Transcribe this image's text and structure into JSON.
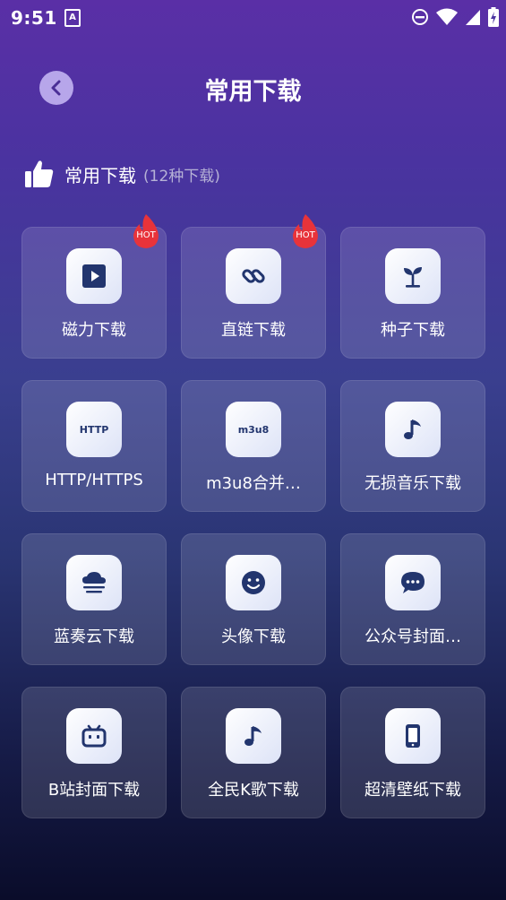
{
  "status_bar": {
    "time": "9:51",
    "notif_icon": "A"
  },
  "header": {
    "title": "常用下载"
  },
  "section": {
    "title": "常用下载",
    "count": "(12种下载)"
  },
  "hot_badge": "HOT",
  "items": [
    {
      "label": "磁力下载",
      "icon": "play-icon",
      "hot": true
    },
    {
      "label": "直链下载",
      "icon": "link-icon",
      "hot": true
    },
    {
      "label": "种子下载",
      "icon": "sprout-icon",
      "hot": false
    },
    {
      "label": "HTTP/HTTPS",
      "icon": "http-icon",
      "icon_text": "HTTP",
      "hot": false
    },
    {
      "label": "m3u8合并…",
      "icon": "m3u8-icon",
      "icon_text": "m3u8",
      "hot": false
    },
    {
      "label": "无损音乐下载",
      "icon": "music-note-icon",
      "hot": false
    },
    {
      "label": "蓝奏云下载",
      "icon": "cloud-icon",
      "hot": false
    },
    {
      "label": "头像下载",
      "icon": "smiley-icon",
      "hot": false
    },
    {
      "label": "公众号封面…",
      "icon": "chat-bubble-icon",
      "hot": false
    },
    {
      "label": "B站封面下载",
      "icon": "bilibili-tv-icon",
      "hot": false
    },
    {
      "label": "全民K歌下载",
      "icon": "music-note-icon",
      "hot": false
    },
    {
      "label": "超清壁纸下载",
      "icon": "phone-icon",
      "hot": false
    }
  ]
}
